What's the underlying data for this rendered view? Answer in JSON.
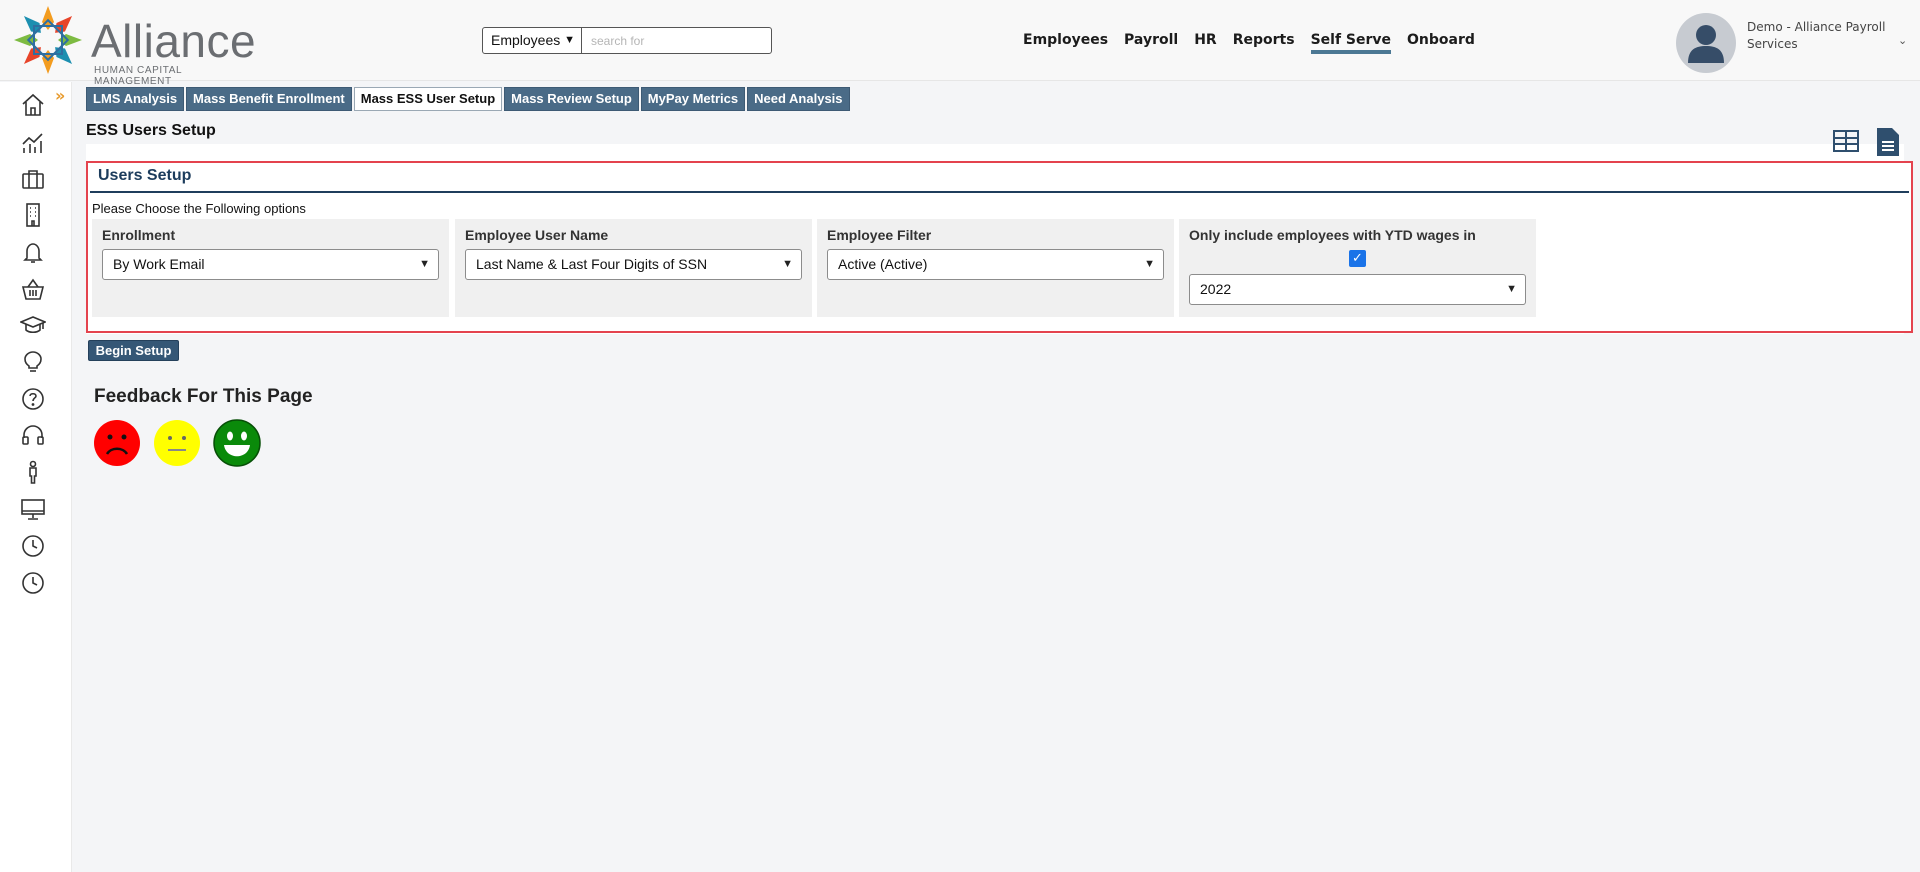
{
  "logo": {
    "word": "Alliance",
    "subtitle": "HUMAN CAPITAL MANAGEMENT"
  },
  "search": {
    "scope": "Employees",
    "placeholder": "search for"
  },
  "topnav": [
    {
      "label": "Employees"
    },
    {
      "label": "Payroll"
    },
    {
      "label": "HR"
    },
    {
      "label": "Reports"
    },
    {
      "label": "Self Serve",
      "active": true
    },
    {
      "label": "Onboard"
    }
  ],
  "user": {
    "name": "Demo - Alliance Payroll Services"
  },
  "sidebar": {
    "icons": [
      "home-icon",
      "analytics-icon",
      "briefcase-icon",
      "building-icon",
      "bell-icon",
      "basket-icon",
      "graduation-cap-icon",
      "lightbulb-icon",
      "help-icon",
      "headset-icon",
      "person-icon",
      "monitor-icon",
      "clock-icon",
      "history-icon"
    ]
  },
  "tabs": [
    {
      "label": "LMS Analysis"
    },
    {
      "label": "Mass Benefit Enrollment"
    },
    {
      "label": "Mass ESS User Setup",
      "active": true
    },
    {
      "label": "Mass Review Setup"
    },
    {
      "label": "MyPay Metrics"
    },
    {
      "label": "Need Analysis"
    }
  ],
  "page": {
    "title": "ESS Users Setup"
  },
  "setup": {
    "title": "Users Setup",
    "hint": "Please Choose the Following options",
    "fields": {
      "enrollment": {
        "label": "Enrollment",
        "value": "By Work Email"
      },
      "username": {
        "label": "Employee User Name",
        "value": "Last Name & Last Four Digits of SSN"
      },
      "filter": {
        "label": "Employee Filter",
        "value": "Active (Active)"
      },
      "ytd": {
        "label": "Only include employees with YTD wages in",
        "checked": true,
        "value": "2022"
      }
    },
    "begin_label": "Begin Setup"
  },
  "feedback": {
    "title": "Feedback For This Page"
  },
  "colors": {
    "accent": "#4a6b87",
    "highlight": "#e4434e",
    "sad": "#ff0000",
    "neutral": "#ffff00",
    "happy": "#0a8a0a"
  }
}
